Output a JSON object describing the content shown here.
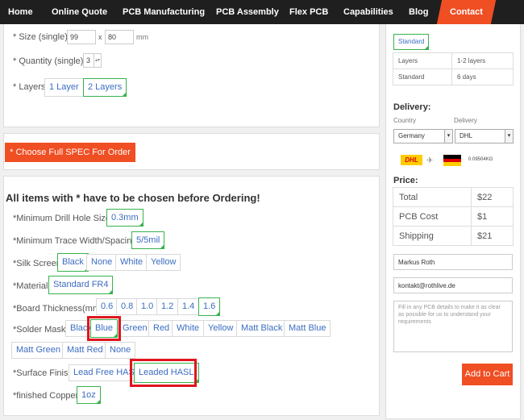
{
  "nav": {
    "items": [
      "Home",
      "Online Quote",
      "PCB Manufacturing",
      "PCB Assembly",
      "Flex PCB",
      "Capabilities",
      "Blog"
    ],
    "active": "Contact"
  },
  "top_form": {
    "size_label": "* Size (single):",
    "size_w": "99",
    "size_x": "x",
    "size_h": "80",
    "size_unit": "mm",
    "qty_label": "* Quantity (single):",
    "qty_value": "3",
    "layers_label": "* Layers:",
    "layer_options": [
      "1 Layer",
      "2 Layers"
    ],
    "layer_selected": "2 Layers"
  },
  "spec_button": "* Choose Full SPEC For Order",
  "options": {
    "heading": "All items with * have to be chosen before Ordering!",
    "drill_label": "*Minimum Drill Hole Size:",
    "drill_value": "0.3mm",
    "trace_label": "*Minimum Trace Width/Spacing:",
    "trace_value": "5/5mil",
    "silk_label": "*Silk Screen:",
    "silk_options": [
      "Black",
      "None",
      "White",
      "Yellow"
    ],
    "silk_selected": "Black",
    "material_label": "*Material:",
    "material_value": "Standard FR4",
    "thickness_label": "*Board Thickness(mm):",
    "thickness_options": [
      "0.6",
      "0.8",
      "1.0",
      "1.2",
      "1.4",
      "1.6"
    ],
    "thickness_selected": "1.6",
    "mask_label": "*Solder Mask:",
    "mask_options": [
      "Black",
      "Blue",
      "Green",
      "Red",
      "White",
      "Yellow",
      "Matt Black",
      "Matt Blue",
      "Matt Green",
      "Matt Red",
      "None"
    ],
    "mask_selected": "Blue",
    "finish_label": "*Surface Finish:",
    "finish_options": [
      "Lead Free HASL",
      "Leaded HASL"
    ],
    "finish_selected": "Leaded HASL",
    "copper_label": "*finished Copper:",
    "copper_value": "1oz"
  },
  "sidebar": {
    "build_tab": "Standard",
    "build_rows": [
      [
        "Layers",
        "1-2 layers"
      ],
      [
        "Standard",
        "6 days"
      ]
    ],
    "delivery_title": "Delivery:",
    "country_label": "Country",
    "delivery_label": "Delivery",
    "country_value": "Germany",
    "delivery_value": "DHL",
    "carrier_logo": "DHL",
    "shipping_weight": "0.09504KG",
    "price_title": "Price:",
    "price_rows": [
      [
        "Total",
        "$22"
      ],
      [
        "PCB Cost",
        "$1"
      ],
      [
        "Shipping",
        "$21"
      ]
    ],
    "name_value": "Markus Roth",
    "email_value": "kontakt@rothlive.de",
    "notes_placeholder": "Fill in any PCB details to make it as clear as possible for us to understand your requirements",
    "cart_button": "Add to Cart"
  },
  "colors": {
    "accent": "#f04e23",
    "selected": "#37b24d",
    "highlight": "#e0151e",
    "nav_bg": "#1f1f1f",
    "link": "#3c6dc0"
  }
}
